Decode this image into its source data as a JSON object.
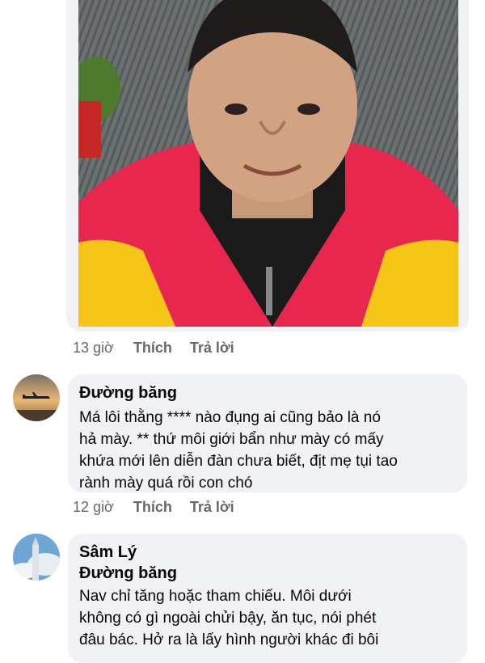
{
  "post_photo": {
    "alt_icon": "profile-photo"
  },
  "comment_meta_1": {
    "time": "13 giờ",
    "like": "Thích",
    "reply": "Trả lời"
  },
  "comments": [
    {
      "author": "Đường băng",
      "lines": [
        "Má lôi thằng **** nào đụng ai cũng bảo là nó",
        "hả mày. ** thứ môi giới bẩn như mày có mấy",
        "khứa mới lên diễn đàn chưa biết, địt mẹ tụi tao",
        "rành mày quá rồi con chó"
      ],
      "time": "12 giờ",
      "like": "Thích",
      "reply": "Trả lời"
    },
    {
      "author": "Sâm Lý",
      "mention": "Đường băng",
      "lines": [
        "Nav chỉ tăng hoặc tham chiếu. Môi dưới",
        "không có gì ngoài chửi bậy, ăn tục, nói phét",
        "đâu bác. Hở ra là lấy hình người khác đi bôi"
      ]
    }
  ],
  "colors": {
    "bubble": "#f0f2f5",
    "meta": "#65676b",
    "text": "#050505"
  }
}
